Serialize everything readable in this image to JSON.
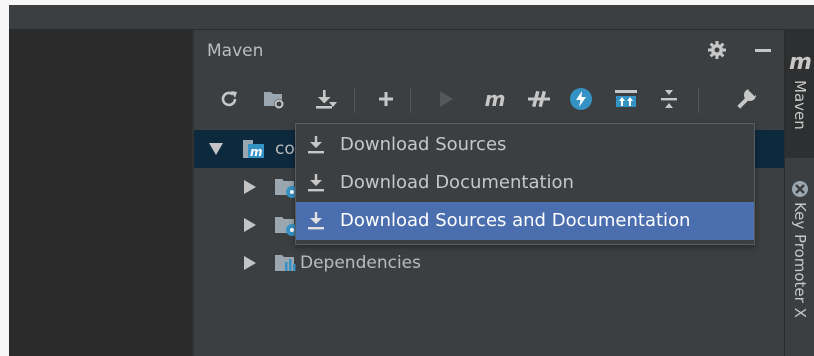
{
  "panel": {
    "title": "Maven"
  },
  "tree": {
    "items": [
      {
        "label": "cos",
        "expanded": true,
        "selected": true
      },
      {
        "label": "",
        "expanded": false
      },
      {
        "label": "",
        "expanded": false
      },
      {
        "label": "Dependencies",
        "expanded": false
      }
    ]
  },
  "popup_menu": {
    "items": [
      {
        "label": "Download Sources",
        "icon": "download-icon",
        "highlighted": false
      },
      {
        "label": "Download Documentation",
        "icon": "download-icon",
        "highlighted": false
      },
      {
        "label": "Download Sources and Documentation",
        "icon": "download-icon",
        "highlighted": true
      }
    ]
  },
  "toolbar": {
    "buttons": [
      "reload-icon",
      "generate-sources-icon",
      "download-icon",
      "add-icon",
      "run-icon",
      "maven-goal-icon",
      "toggle-offline-icon",
      "skip-tests-icon",
      "show-dependencies-icon",
      "collapse-all-icon",
      "settings-wrench-icon"
    ],
    "maven_label": "m"
  },
  "side_tabs": {
    "maven_glyph": "m",
    "maven_label": "Maven",
    "keypromoter_label": "Key Promoter X"
  },
  "colors": {
    "panel_bg": "#3c3f41",
    "editor_bg": "#2b2b2b",
    "selection_bg": "#0d293e",
    "highlight_bg": "#4b6eaf",
    "text": "#bbbbbb",
    "accent_blue": "#3592c4"
  }
}
